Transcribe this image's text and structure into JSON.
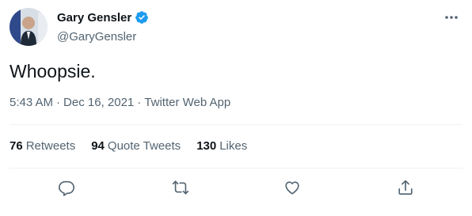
{
  "author": {
    "name": "Gary Gensler",
    "handle": "@GaryGensler",
    "verified_icon": "verified-badge-icon",
    "accent": "#1d9bf0"
  },
  "tweet": {
    "text": "Whoopsie.",
    "time": "5:43 AM",
    "date": "Dec 16, 2021",
    "source": "Twitter Web App",
    "separator": "·"
  },
  "stats": [
    {
      "count": "76",
      "label": "Retweets"
    },
    {
      "count": "94",
      "label": "Quote Tweets"
    },
    {
      "count": "130",
      "label": "Likes"
    }
  ],
  "actions": [
    "reply-icon",
    "retweet-icon",
    "like-icon",
    "share-icon"
  ],
  "colors": {
    "text_primary": "#0f1419",
    "text_secondary": "#536471",
    "divider": "#eff3f4"
  }
}
